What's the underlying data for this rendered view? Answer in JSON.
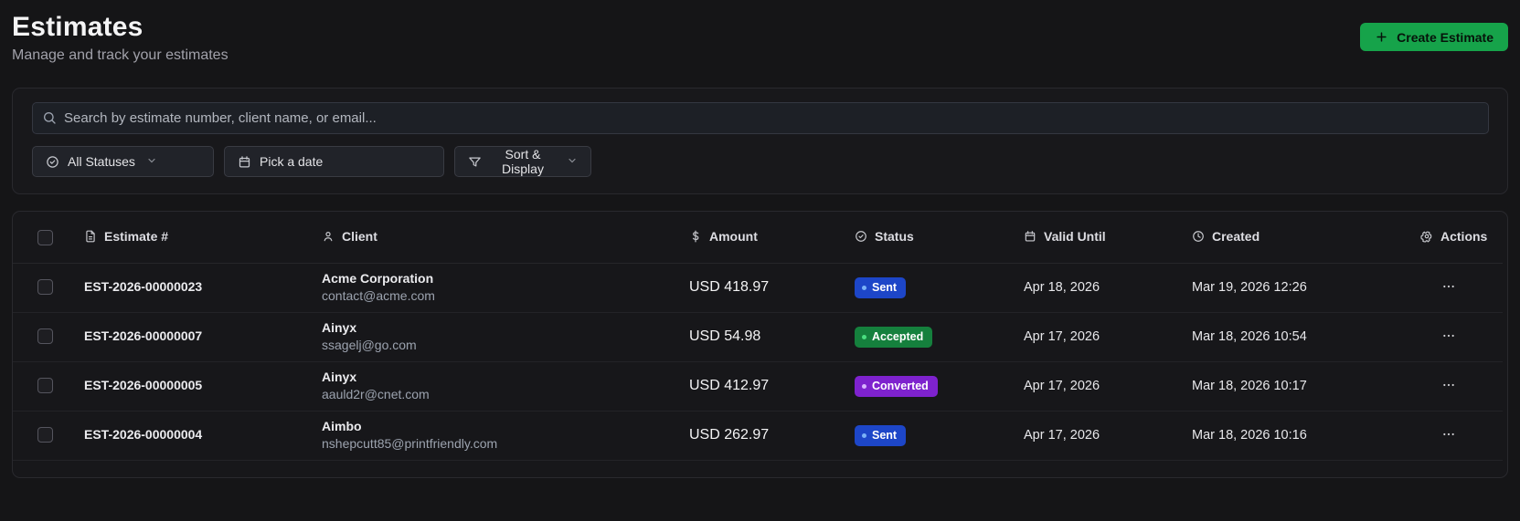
{
  "page": {
    "title": "Estimates",
    "subtitle": "Manage and track your estimates"
  },
  "header": {
    "create_button_label": "Create Estimate"
  },
  "filters": {
    "search_placeholder": "Search by estimate number, client name, or email...",
    "status_filter_label": "All Statuses",
    "date_filter_label": "Pick a date",
    "sort_display_label": "Sort & Display"
  },
  "table": {
    "headers": {
      "estimate": "Estimate #",
      "client": "Client",
      "amount": "Amount",
      "status": "Status",
      "valid_until": "Valid Until",
      "created": "Created",
      "actions": "Actions"
    },
    "rows": [
      {
        "estimate": "EST-2026-00000023",
        "client_name": "Acme Corporation",
        "client_email": "contact@acme.com",
        "amount": "USD 418.97",
        "status": "Sent",
        "status_variant": "sent",
        "valid_until": "Apr 18, 2026",
        "created": "Mar 19, 2026 12:26"
      },
      {
        "estimate": "EST-2026-00000007",
        "client_name": "Ainyx",
        "client_email": "ssagelj@go.com",
        "amount": "USD 54.98",
        "status": "Accepted",
        "status_variant": "accepted",
        "valid_until": "Apr 17, 2026",
        "created": "Mar 18, 2026 10:54"
      },
      {
        "estimate": "EST-2026-00000005",
        "client_name": "Ainyx",
        "client_email": "aauld2r@cnet.com",
        "amount": "USD 412.97",
        "status": "Converted",
        "status_variant": "converted",
        "valid_until": "Apr 17, 2026",
        "created": "Mar 18, 2026 10:17"
      },
      {
        "estimate": "EST-2026-00000004",
        "client_name": "Aimbo",
        "client_email": "nshepcutt85@printfriendly.com",
        "amount": "USD 262.97",
        "status": "Sent",
        "status_variant": "sent",
        "valid_until": "Apr 17, 2026",
        "created": "Mar 18, 2026 10:16"
      }
    ]
  },
  "colors": {
    "accent_green": "#16a34a",
    "badge_sent": "#1d46c8",
    "badge_accepted": "#15803d",
    "badge_converted": "#7e22ce",
    "page_background": "#151517"
  }
}
